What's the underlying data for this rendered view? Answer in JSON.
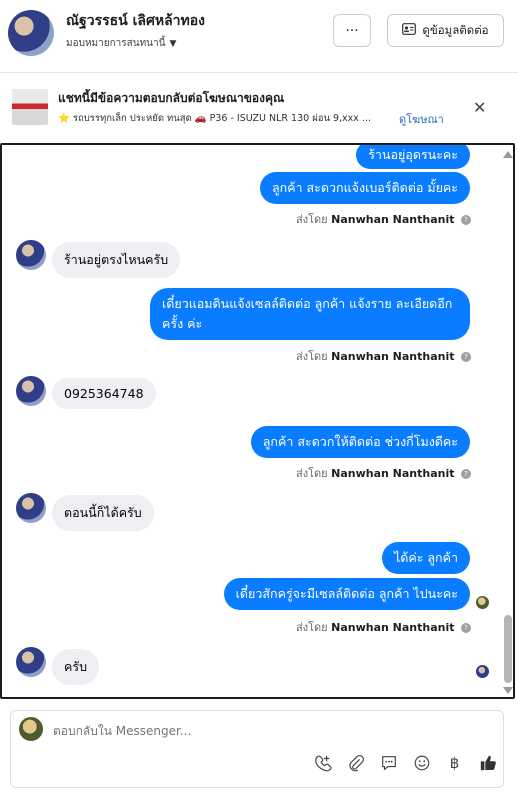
{
  "header": {
    "name": "ณัฐวรรธน์ เลิศหล้าทอง",
    "assign_label": "มอบหมายการสนทนานี้",
    "more_label": "···",
    "contact_button": "ดูข้อมูลติดต่อ"
  },
  "ad": {
    "title": "แชทนี้มีข้อความตอบกลับต่อโฆษณาของคุณ",
    "description": "⭐ รถบรรทุกเล็ก ประหยัด ทนสุด 🚗 P36 - ISUZU NLR 130 ผ่อน 9,xxx ...",
    "link": "ดูโฆษณา",
    "close_icon": "✕"
  },
  "messages": {
    "m1": "ร้านอยู่อุดรนะคะ",
    "m2": "ลูกค้า สะดวกแจ้งเบอร์ติดต่อ มั้ยคะ",
    "m3": "ร้านอยู่ตรงไหนครับ",
    "m4": "เดี๋ยวแอมดินแจ้งเซลล์ติดต่อ ลูกค้า  แจ้งราย ละเอียดอีกครั้ง ค่ะ",
    "m5": "0925364748",
    "m6": "ลูกค้า สะดวกให้ติดต่อ ช่วงกี่โมงดีคะ",
    "m7": "ตอนนี้ก็ได้ครับ",
    "m8": "ได้ค่ะ  ลูกค้า",
    "m9": "เดี๋ยวสักครู่จะมีเซลล์ติดต่อ ลูกค้า ไปนะคะ",
    "m10": "ครับ"
  },
  "sent_by": {
    "prefix": "ส่งโดย",
    "name": "Nanwhan Nanthanit"
  },
  "composer": {
    "placeholder": "ตอบกลับใน Messenger..."
  },
  "icons": {
    "baht": "฿"
  }
}
